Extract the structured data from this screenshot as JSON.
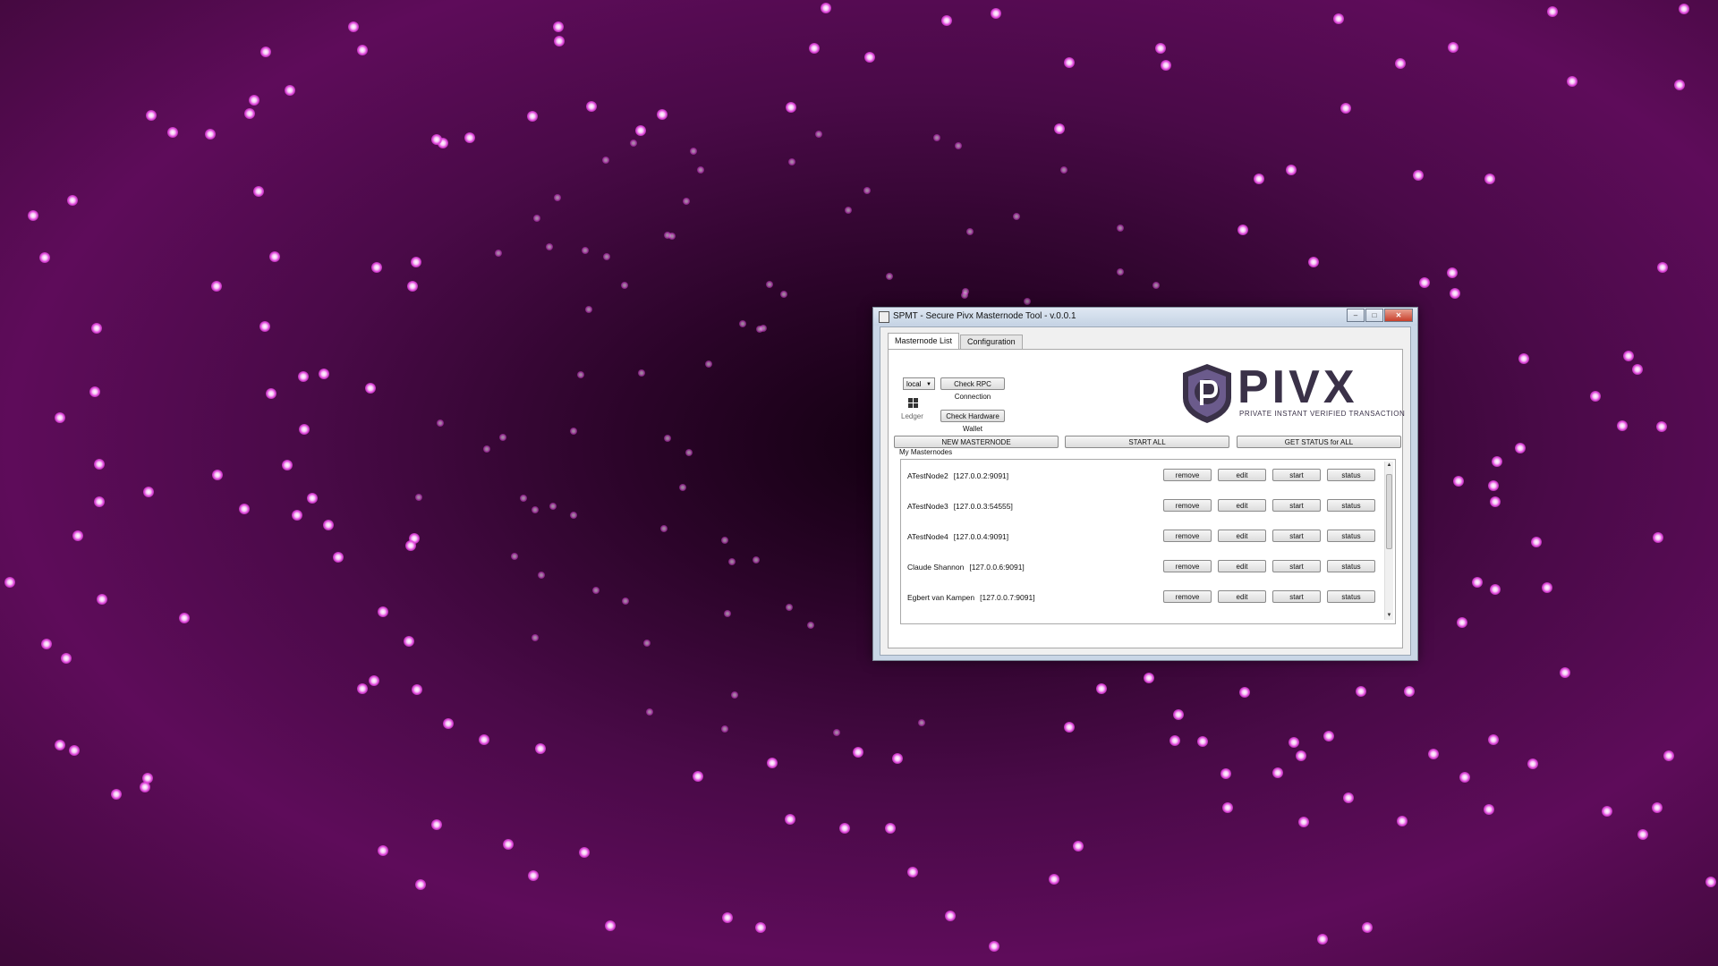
{
  "window": {
    "title": "SPMT - Secure Pivx Masternode Tool - v.0.0.1",
    "controls": {
      "minimize": "–",
      "maximize": "□",
      "close": "✕"
    }
  },
  "tabs": [
    {
      "label": "Masternode List",
      "active": true
    },
    {
      "label": "Configuration",
      "active": false
    }
  ],
  "rpc": {
    "selected_server": "local",
    "check_rpc_label": "Check RPC Connection",
    "check_hw_label": "Check Hardware Wallet",
    "hw_brand": "Ledger"
  },
  "logo": {
    "word": "PIVX",
    "tagline": "PRIVATE  INSTANT  VERIFIED  TRANSACTION",
    "colors": {
      "primary": "#3a3148",
      "accent": "#6b5b8c"
    }
  },
  "actions": {
    "new_masternode": "NEW MASTERNODE",
    "start_all": "START ALL",
    "get_status_all": "GET STATUS for ALL"
  },
  "masternodes": {
    "group_label": "My Masternodes",
    "row_buttons": {
      "remove": "remove",
      "edit": "edit",
      "start": "start",
      "status": "status"
    },
    "rows": [
      {
        "name": "ATestNode2",
        "address": "[127.0.0.2:9091]"
      },
      {
        "name": "ATestNode3",
        "address": "[127.0.0.3:54555]"
      },
      {
        "name": "ATestNode4",
        "address": "[127.0.0.4:9091]"
      },
      {
        "name": "Claude Shannon",
        "address": "[127.0.0.6:9091]"
      },
      {
        "name": "Egbert van Kampen",
        "address": "[127.0.0.7:9091]"
      }
    ]
  },
  "desktop": {
    "background_color": "#4a0a48",
    "dot_color": "#e046dc"
  }
}
